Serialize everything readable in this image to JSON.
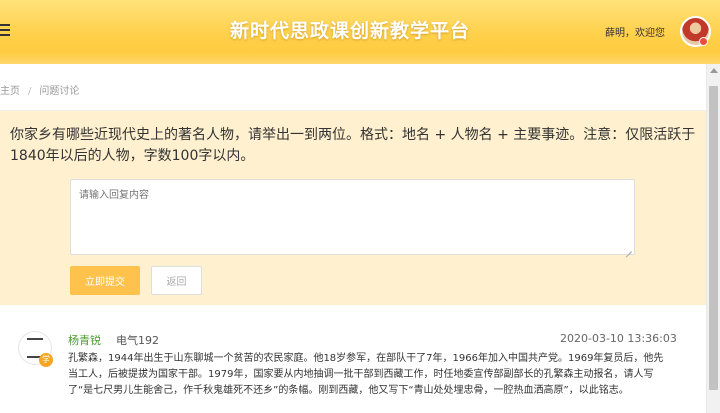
{
  "header": {
    "title": "新时代思政课创新教学平台",
    "welcome": "薛明，欢迎您"
  },
  "breadcrumb": {
    "items": [
      "主页",
      "问题讨论"
    ],
    "separator": "/"
  },
  "question": {
    "text": "你家乡有哪些近现代史上的著名人物，请举出一到两位。格式：地名 + 人物名 + 主要事迹。注意：仅限活跃于1840年以后的人物，字数100字以内。"
  },
  "reply": {
    "placeholder": "请输入回复内容",
    "submit_label": "立即提交",
    "back_label": "返回"
  },
  "comments": [
    {
      "name": "杨青锐",
      "class": "电气192",
      "time": "2020-03-10 13:36:03",
      "badge": "学",
      "text": "孔繁森，1944年出生于山东聊城一个贫苦的农民家庭。他18岁参军，在部队干了7年，1966年加入中国共产党。1969年复员后，他先当工人，后被提拔为国家干部。1979年，国家要从内地抽调一批干部到西藏工作，时任地委宣传部副部长的孔繁森主动报名，请人写了“是七尺男儿生能舍己，作千秋鬼雄死不还乡”的条幅。刚到西藏，他又写下“青山处处埋忠骨，一腔热血洒高原”，以此铭志。"
    }
  ],
  "colors": {
    "header_gradient_top": "#ffe27a",
    "header_gradient_bottom": "#ffc93a",
    "panel_bg": "#fff0cf",
    "submit_bg": "#ffc24d",
    "name_color": "#4b9a2e"
  },
  "icons": {
    "menu": "menu-icon",
    "avatar": "user-avatar",
    "resize": "resize-grip-icon"
  }
}
